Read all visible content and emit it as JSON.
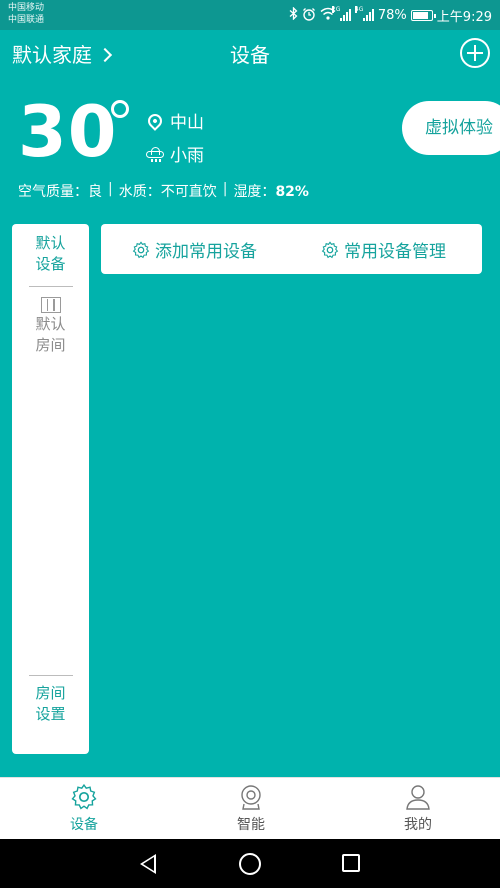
{
  "status_bar": {
    "carrier1": "中国移动",
    "carrier2": "中国联通",
    "net1": "2G",
    "net2": "4G",
    "battery": "78%",
    "battery_level": 0.78,
    "time": "上午9:29",
    "icons": [
      "bluetooth-icon",
      "alarm-icon",
      "wifi-icon",
      "signal-icon",
      "battery-icon"
    ]
  },
  "header": {
    "home_name": "默认家庭",
    "title": "设备"
  },
  "weather": {
    "temperature": "30",
    "location": "中山",
    "condition": "小雨",
    "air_quality_label": "空气质量：",
    "air_quality": "良",
    "water_quality_label": "水质：",
    "water_quality": "不可直饮",
    "humidity_label": "湿度：",
    "humidity": "82%"
  },
  "virtual_experience": "虚拟体验",
  "sidebar": {
    "default_devices": "默认设备",
    "default_devices_l1": "默认",
    "default_devices_l2": "设备",
    "room_l1": "默认",
    "room_l2": "房间",
    "settings_l1": "房间",
    "settings_l2": "设置"
  },
  "common": {
    "add": "添加常用设备",
    "manage": "常用设备管理"
  },
  "tabs": {
    "devices": "设备",
    "smart": "智能",
    "mine": "我的"
  },
  "colors": {
    "background": "#00b3ad",
    "accent": "#16a39d",
    "status_bar": "#0d9791"
  }
}
